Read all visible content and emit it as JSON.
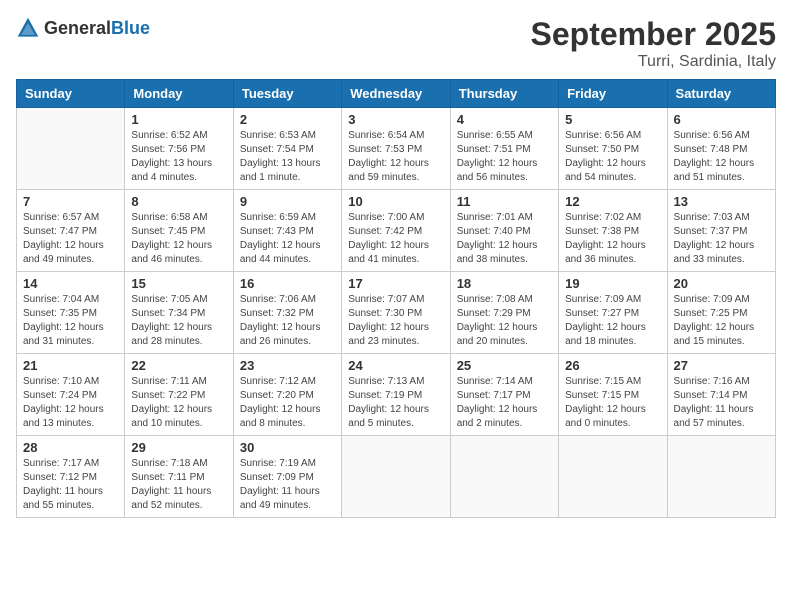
{
  "header": {
    "logo_general": "General",
    "logo_blue": "Blue",
    "month_title": "September 2025",
    "location": "Turri, Sardinia, Italy"
  },
  "days_of_week": [
    "Sunday",
    "Monday",
    "Tuesday",
    "Wednesday",
    "Thursday",
    "Friday",
    "Saturday"
  ],
  "weeks": [
    [
      {
        "day": "",
        "info": ""
      },
      {
        "day": "1",
        "info": "Sunrise: 6:52 AM\nSunset: 7:56 PM\nDaylight: 13 hours\nand 4 minutes."
      },
      {
        "day": "2",
        "info": "Sunrise: 6:53 AM\nSunset: 7:54 PM\nDaylight: 13 hours\nand 1 minute."
      },
      {
        "day": "3",
        "info": "Sunrise: 6:54 AM\nSunset: 7:53 PM\nDaylight: 12 hours\nand 59 minutes."
      },
      {
        "day": "4",
        "info": "Sunrise: 6:55 AM\nSunset: 7:51 PM\nDaylight: 12 hours\nand 56 minutes."
      },
      {
        "day": "5",
        "info": "Sunrise: 6:56 AM\nSunset: 7:50 PM\nDaylight: 12 hours\nand 54 minutes."
      },
      {
        "day": "6",
        "info": "Sunrise: 6:56 AM\nSunset: 7:48 PM\nDaylight: 12 hours\nand 51 minutes."
      }
    ],
    [
      {
        "day": "7",
        "info": "Sunrise: 6:57 AM\nSunset: 7:47 PM\nDaylight: 12 hours\nand 49 minutes."
      },
      {
        "day": "8",
        "info": "Sunrise: 6:58 AM\nSunset: 7:45 PM\nDaylight: 12 hours\nand 46 minutes."
      },
      {
        "day": "9",
        "info": "Sunrise: 6:59 AM\nSunset: 7:43 PM\nDaylight: 12 hours\nand 44 minutes."
      },
      {
        "day": "10",
        "info": "Sunrise: 7:00 AM\nSunset: 7:42 PM\nDaylight: 12 hours\nand 41 minutes."
      },
      {
        "day": "11",
        "info": "Sunrise: 7:01 AM\nSunset: 7:40 PM\nDaylight: 12 hours\nand 38 minutes."
      },
      {
        "day": "12",
        "info": "Sunrise: 7:02 AM\nSunset: 7:38 PM\nDaylight: 12 hours\nand 36 minutes."
      },
      {
        "day": "13",
        "info": "Sunrise: 7:03 AM\nSunset: 7:37 PM\nDaylight: 12 hours\nand 33 minutes."
      }
    ],
    [
      {
        "day": "14",
        "info": "Sunrise: 7:04 AM\nSunset: 7:35 PM\nDaylight: 12 hours\nand 31 minutes."
      },
      {
        "day": "15",
        "info": "Sunrise: 7:05 AM\nSunset: 7:34 PM\nDaylight: 12 hours\nand 28 minutes."
      },
      {
        "day": "16",
        "info": "Sunrise: 7:06 AM\nSunset: 7:32 PM\nDaylight: 12 hours\nand 26 minutes."
      },
      {
        "day": "17",
        "info": "Sunrise: 7:07 AM\nSunset: 7:30 PM\nDaylight: 12 hours\nand 23 minutes."
      },
      {
        "day": "18",
        "info": "Sunrise: 7:08 AM\nSunset: 7:29 PM\nDaylight: 12 hours\nand 20 minutes."
      },
      {
        "day": "19",
        "info": "Sunrise: 7:09 AM\nSunset: 7:27 PM\nDaylight: 12 hours\nand 18 minutes."
      },
      {
        "day": "20",
        "info": "Sunrise: 7:09 AM\nSunset: 7:25 PM\nDaylight: 12 hours\nand 15 minutes."
      }
    ],
    [
      {
        "day": "21",
        "info": "Sunrise: 7:10 AM\nSunset: 7:24 PM\nDaylight: 12 hours\nand 13 minutes."
      },
      {
        "day": "22",
        "info": "Sunrise: 7:11 AM\nSunset: 7:22 PM\nDaylight: 12 hours\nand 10 minutes."
      },
      {
        "day": "23",
        "info": "Sunrise: 7:12 AM\nSunset: 7:20 PM\nDaylight: 12 hours\nand 8 minutes."
      },
      {
        "day": "24",
        "info": "Sunrise: 7:13 AM\nSunset: 7:19 PM\nDaylight: 12 hours\nand 5 minutes."
      },
      {
        "day": "25",
        "info": "Sunrise: 7:14 AM\nSunset: 7:17 PM\nDaylight: 12 hours\nand 2 minutes."
      },
      {
        "day": "26",
        "info": "Sunrise: 7:15 AM\nSunset: 7:15 PM\nDaylight: 12 hours\nand 0 minutes."
      },
      {
        "day": "27",
        "info": "Sunrise: 7:16 AM\nSunset: 7:14 PM\nDaylight: 11 hours\nand 57 minutes."
      }
    ],
    [
      {
        "day": "28",
        "info": "Sunrise: 7:17 AM\nSunset: 7:12 PM\nDaylight: 11 hours\nand 55 minutes."
      },
      {
        "day": "29",
        "info": "Sunrise: 7:18 AM\nSunset: 7:11 PM\nDaylight: 11 hours\nand 52 minutes."
      },
      {
        "day": "30",
        "info": "Sunrise: 7:19 AM\nSunset: 7:09 PM\nDaylight: 11 hours\nand 49 minutes."
      },
      {
        "day": "",
        "info": ""
      },
      {
        "day": "",
        "info": ""
      },
      {
        "day": "",
        "info": ""
      },
      {
        "day": "",
        "info": ""
      }
    ]
  ]
}
